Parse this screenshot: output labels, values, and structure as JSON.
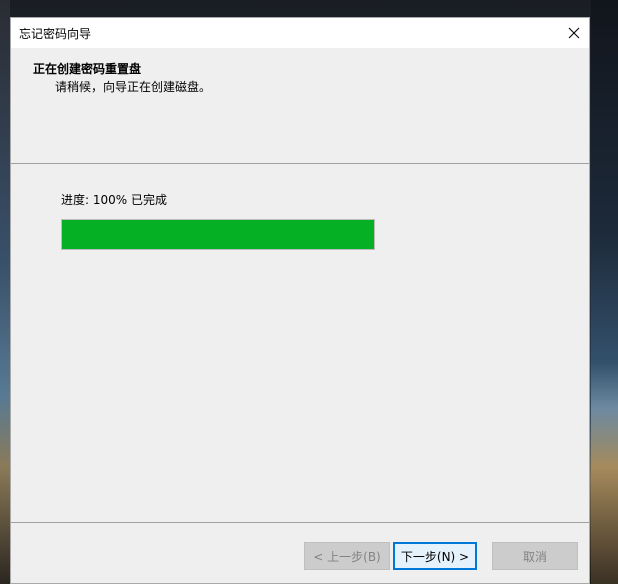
{
  "window": {
    "title": "忘记密码向导"
  },
  "header": {
    "title": "正在创建密码重置盘",
    "subtitle": "请稍候，向导正在创建磁盘。"
  },
  "progress": {
    "label": "进度: 100% 已完成",
    "value_percent": 100,
    "fill_color": "#06b025"
  },
  "buttons": {
    "back": "< 上一步(B)",
    "next": "下一步(N) >",
    "cancel": "取消"
  },
  "icons": {
    "close": "close-icon"
  }
}
